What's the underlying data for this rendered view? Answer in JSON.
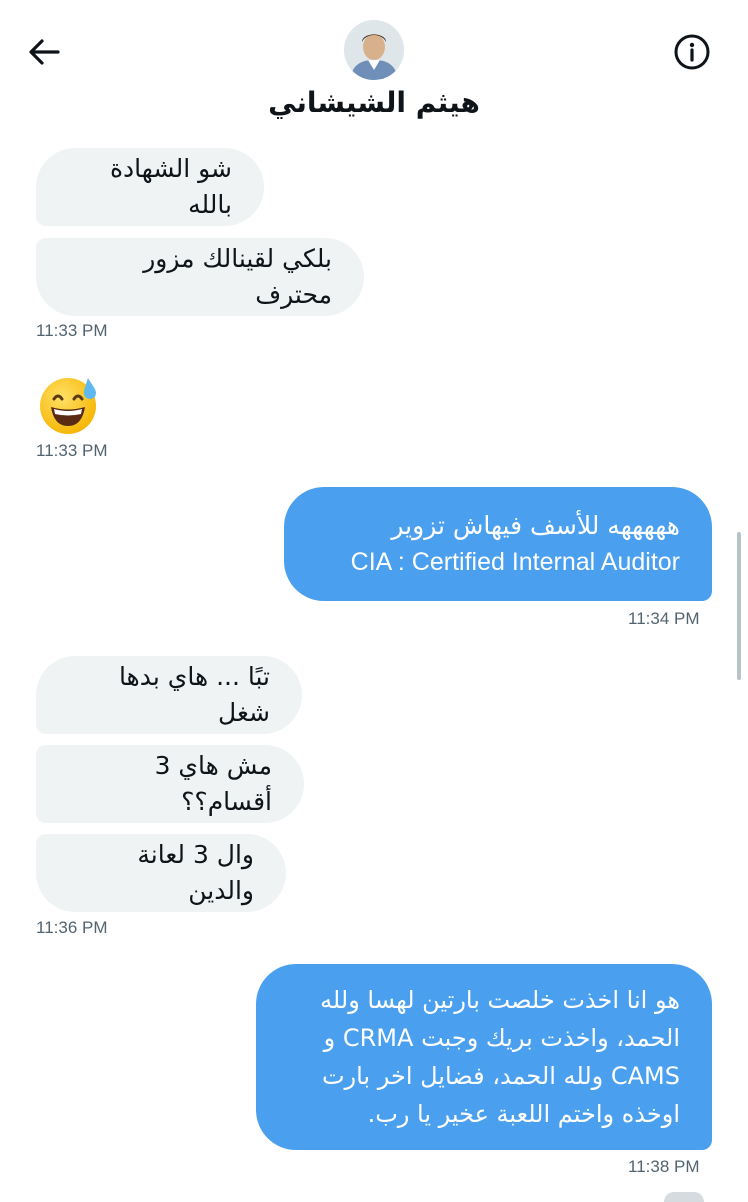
{
  "header": {
    "title": "هيثم الشيشاني",
    "back_icon": "arrow-left-icon",
    "info_icon": "info-icon"
  },
  "messages": [
    {
      "direction": "in",
      "text": "شو الشهادة بالله"
    },
    {
      "direction": "in",
      "text": "بلكي لقينالك مزور محترف",
      "time": "11:33 PM"
    },
    {
      "direction": "in",
      "emoji": "grinning-face-with-sweat",
      "time": "11:33 PM"
    },
    {
      "direction": "out",
      "lines": [
        "هههههه للأسف فيهاش تزوير",
        "CIA : Certified Internal Auditor"
      ],
      "time": "11:34 PM"
    },
    {
      "direction": "in",
      "text": "تبًا ... هاي بدها شغل"
    },
    {
      "direction": "in",
      "text": "مش هاي 3 أقسام؟؟"
    },
    {
      "direction": "in",
      "text": "وال 3 لعانة والدين",
      "time": "11:36 PM"
    },
    {
      "direction": "out",
      "lines": [
        "هو انا اخذت خلصت بارتين لهسا ولله",
        "الحمد، واخذت بريك وجبت CRMA و",
        "CAMS ولله الحمد، فضايل اخر بارت",
        "اوخذه واختم اللعبة عخير يا رب."
      ],
      "time": "11:38 PM"
    }
  ],
  "colors": {
    "incoming_bubble": "#eff3f4",
    "outgoing_bubble": "#4a9fef",
    "timestamp": "#536471"
  }
}
